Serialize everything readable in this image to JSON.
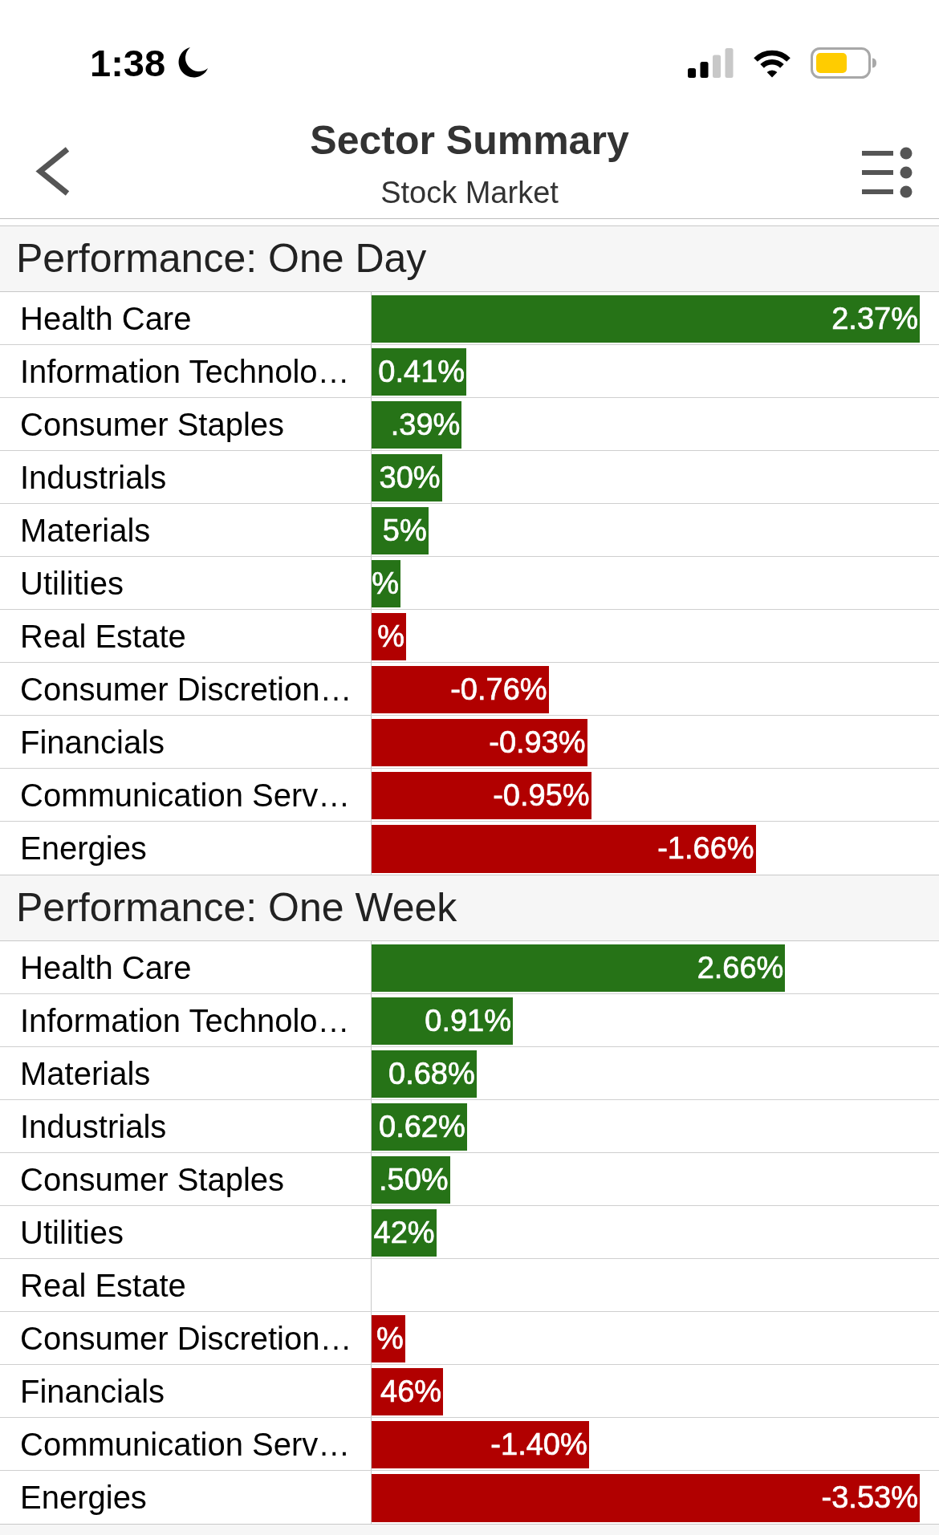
{
  "status_bar": {
    "time": "1:38"
  },
  "header": {
    "title": "Sector Summary",
    "subtitle": "Stock Market"
  },
  "sections": [
    {
      "title": "Performance: One Day",
      "rows": [
        {
          "label": "Health Care",
          "value": "2.37%",
          "level": 0.966,
          "color": "#267317"
        },
        {
          "label": "Information Technolo…",
          "value": "0.41%",
          "level": 0.167,
          "color": "#267317"
        },
        {
          "label": "Consumer Staples",
          "value": ".39%",
          "level": 0.159,
          "color": "#267317"
        },
        {
          "label": "Industrials",
          "value": "30%",
          "level": 0.124,
          "color": "#267317"
        },
        {
          "label": "Materials",
          "value": "5%",
          "level": 0.1,
          "color": "#267317"
        },
        {
          "label": "Utilities",
          "value": "%",
          "level": 0.051,
          "color": "#267317"
        },
        {
          "label": "Real Estate",
          "value": "%",
          "level": 0.061,
          "color": "#b10000"
        },
        {
          "label": "Consumer Discretion…",
          "value": "-0.76%",
          "level": 0.312,
          "color": "#b10000"
        },
        {
          "label": "Financials",
          "value": "-0.93%",
          "level": 0.38,
          "color": "#b10000"
        },
        {
          "label": "Communication Serv…",
          "value": "-0.95%",
          "level": 0.387,
          "color": "#b10000"
        },
        {
          "label": "Energies",
          "value": "-1.66%",
          "level": 0.677,
          "color": "#b10000"
        }
      ]
    },
    {
      "title": "Performance: One Week",
      "rows": [
        {
          "label": "Health Care",
          "value": "2.66%",
          "level": 0.729,
          "color": "#267317"
        },
        {
          "label": "Information Technolo…",
          "value": "0.91%",
          "level": 0.249,
          "color": "#267317"
        },
        {
          "label": "Materials",
          "value": "0.68%",
          "level": 0.185,
          "color": "#267317"
        },
        {
          "label": "Industrials",
          "value": "0.62%",
          "level": 0.168,
          "color": "#267317"
        },
        {
          "label": "Consumer Staples",
          "value": ".50%",
          "level": 0.138,
          "color": "#267317"
        },
        {
          "label": "Utilities",
          "value": "42%",
          "level": 0.114,
          "color": "#267317"
        },
        {
          "label": "Real Estate"
        },
        {
          "label": "Consumer Discretion…",
          "value": "%",
          "level": 0.059,
          "color": "#b10000"
        },
        {
          "label": "Financials",
          "value": "46%",
          "level": 0.126,
          "color": "#b10000"
        },
        {
          "label": "Communication Serv…",
          "value": "-1.40%",
          "level": 0.383,
          "color": "#b10000"
        },
        {
          "label": "Energies",
          "value": "-3.53%",
          "level": 0.966,
          "color": "#b10000"
        }
      ]
    }
  ]
}
